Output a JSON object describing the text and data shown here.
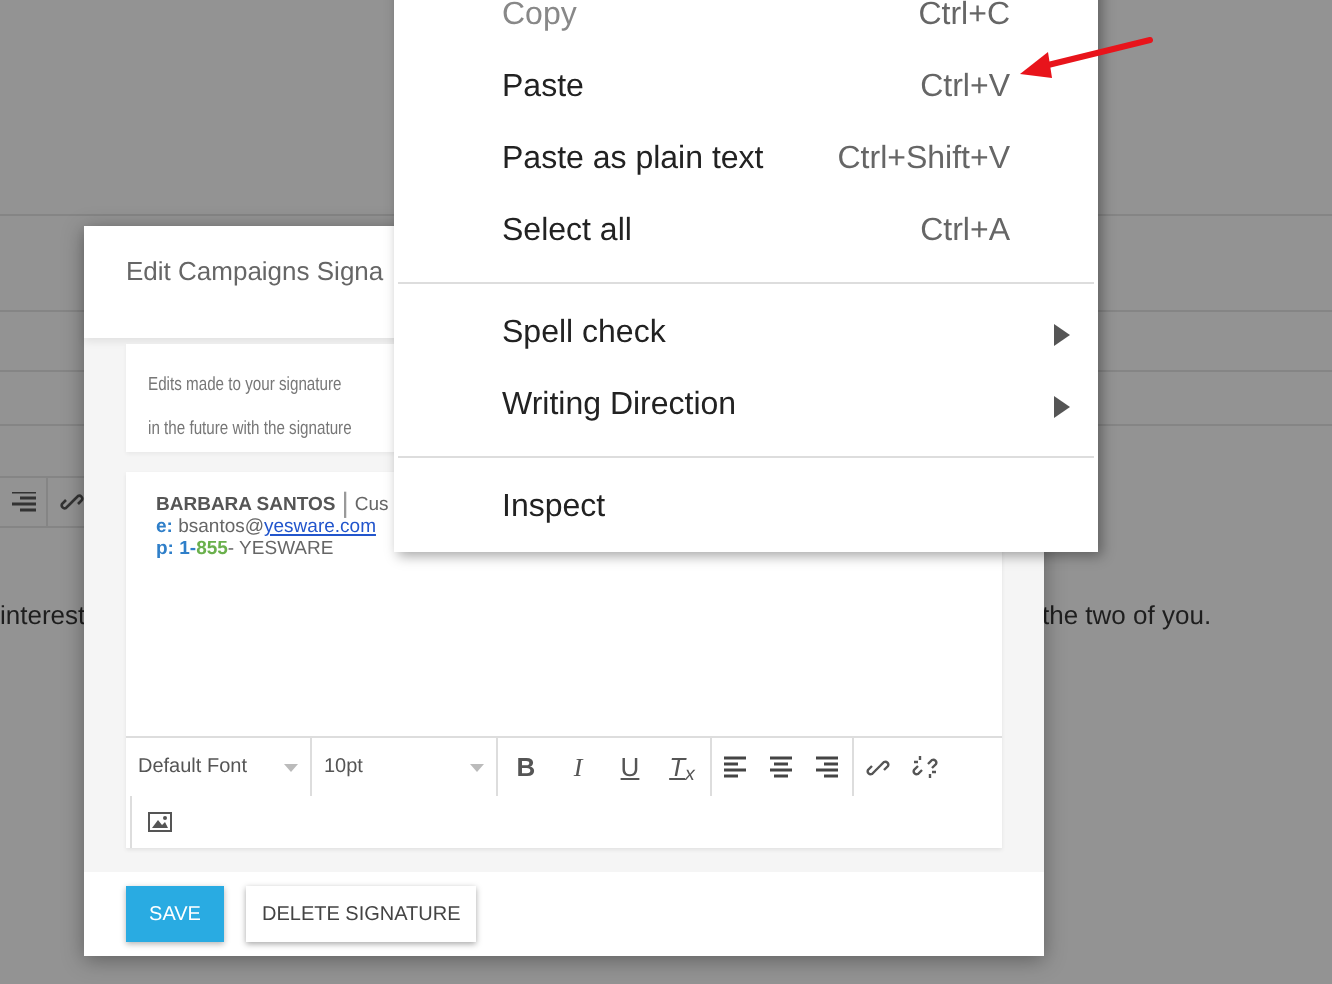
{
  "background": {
    "text_left": "interest",
    "text_right": "the two of you."
  },
  "dialog": {
    "title": "Edit Campaigns Signa",
    "notice": [
      "Edits made to your signature",
      "in the future with the signature"
    ],
    "signature": {
      "name": "BARBARA SANTOS",
      "separator": "|",
      "role": "Cus",
      "email_label": "e:",
      "email_user": "bsantos@",
      "email_domain": "yesware.com",
      "phone_label": "p:",
      "phone_prefix": "1-",
      "phone_number": "855",
      "phone_suffix": "- YESWARE"
    },
    "toolbar": {
      "font": "Default Font",
      "size": "10pt",
      "format_buttons": [
        "B",
        "I",
        "U",
        "T$_{x}$"
      ]
    },
    "buttons": [
      {
        "label": "SAVE",
        "kind": "primary"
      },
      {
        "label": "DELETE SIGNATURE",
        "kind": "secondary"
      }
    ]
  },
  "context_menu": {
    "items": [
      {
        "kind": "item",
        "label": "Copy",
        "shortcut": "Ctrl+C",
        "disabled": true
      },
      {
        "kind": "item",
        "label": "Paste",
        "shortcut": "Ctrl+V",
        "disabled": false
      },
      {
        "kind": "item",
        "label": "Paste as plain text",
        "shortcut": "Ctrl+Shift+V",
        "disabled": false
      },
      {
        "kind": "item",
        "label": "Select all",
        "shortcut": "Ctrl+A",
        "disabled": false
      },
      {
        "kind": "separator"
      },
      {
        "kind": "submenu",
        "label": "Spell check",
        "disabled": false
      },
      {
        "kind": "submenu",
        "label": "Writing Direction",
        "disabled": false
      },
      {
        "kind": "separator"
      },
      {
        "kind": "item",
        "label": "Inspect",
        "disabled": false
      }
    ]
  }
}
